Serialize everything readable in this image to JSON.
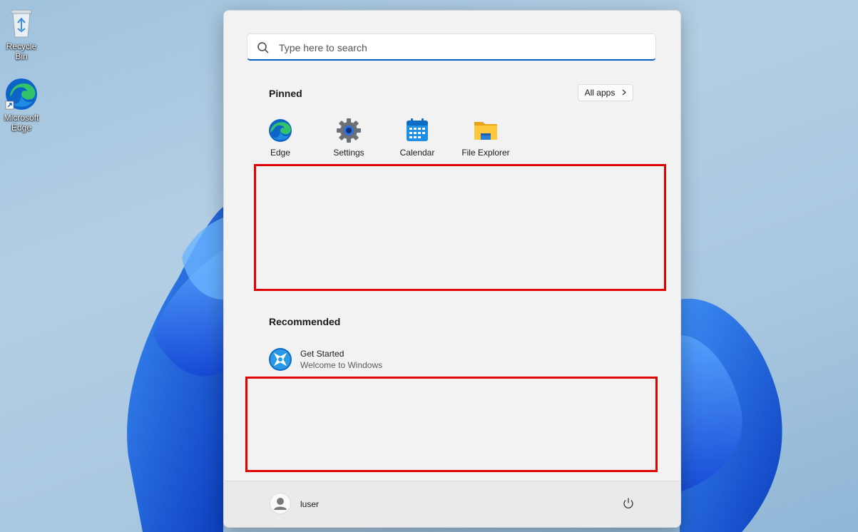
{
  "desktop": {
    "icons": [
      {
        "label": "Recycle Bin",
        "icon": "recycle-bin-icon"
      },
      {
        "label": "Microsoft Edge",
        "icon": "edge-icon"
      }
    ]
  },
  "start_menu": {
    "search": {
      "placeholder": "Type here to search",
      "value": ""
    },
    "pinned": {
      "title": "Pinned",
      "all_apps_label": "All apps",
      "apps": [
        {
          "label": "Edge",
          "icon": "edge-icon"
        },
        {
          "label": "Settings",
          "icon": "gear-icon"
        },
        {
          "label": "Calendar",
          "icon": "calendar-icon"
        },
        {
          "label": "File Explorer",
          "icon": "folder-icon"
        }
      ]
    },
    "recommended": {
      "title": "Recommended",
      "items": [
        {
          "title": "Get Started",
          "subtitle": "Welcome to Windows",
          "icon": "get-started-icon"
        }
      ]
    },
    "footer": {
      "user_name": "luser",
      "power_icon": "power-icon"
    }
  },
  "colors": {
    "accent": "#005fb8",
    "highlight_box": "#e00000",
    "menu_bg": "#f2f2f2",
    "wallpaper_bloom": "#1a5ee8"
  }
}
